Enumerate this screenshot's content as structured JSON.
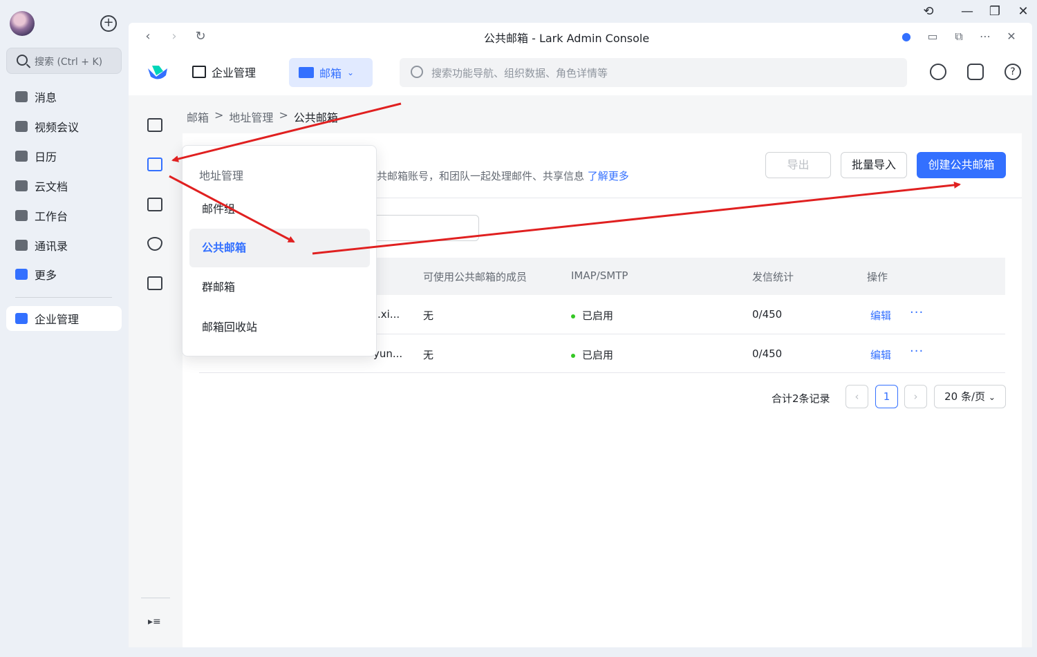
{
  "window": {
    "title": "公共邮箱 - Lark Admin Console"
  },
  "sidebar": {
    "search_placeholder": "搜索 (Ctrl + K)",
    "items": [
      {
        "label": "消息"
      },
      {
        "label": "视频会议"
      },
      {
        "label": "日历"
      },
      {
        "label": "云文档"
      },
      {
        "label": "工作台"
      },
      {
        "label": "通讯录"
      },
      {
        "label": "更多"
      }
    ],
    "active_item": "企业管理"
  },
  "header": {
    "enterprise_label": "企业管理",
    "mail_label": "邮箱",
    "search_placeholder": "搜索功能导航、组织数据、角色详情等"
  },
  "breadcrumb": [
    "邮箱",
    "地址管理",
    "公共邮箱"
  ],
  "breadcrumb_sep": ">",
  "page": {
    "description": "共邮箱账号，和团队一起处理邮件、共享信息",
    "learn_more": "了解更多",
    "export_label": "导出",
    "import_label": "批量导入",
    "create_label": "创建公共邮箱"
  },
  "table": {
    "columns": [
      "可使用公共邮箱的成员",
      "IMAP/SMTP",
      "发信统计",
      "操作"
    ],
    "rows": [
      {
        "address": ".xi...",
        "members": "无",
        "imap": "已启用",
        "stats": "0/450",
        "action": "编辑"
      },
      {
        "address": "yun...",
        "members": "无",
        "imap": "已启用",
        "stats": "0/450",
        "action": "编辑"
      }
    ]
  },
  "pagination": {
    "total": "合计2条记录",
    "page": "1",
    "per_page": "20 条/页"
  },
  "menu": {
    "header": "地址管理",
    "items": [
      {
        "label": "邮件组"
      },
      {
        "label": "公共邮箱"
      },
      {
        "label": "群邮箱"
      },
      {
        "label": "邮箱回收站"
      }
    ],
    "selected": "公共邮箱"
  },
  "colors": {
    "accent": "#3370ff",
    "annotation_arrow": "#e02020",
    "status_green": "#34c724"
  }
}
